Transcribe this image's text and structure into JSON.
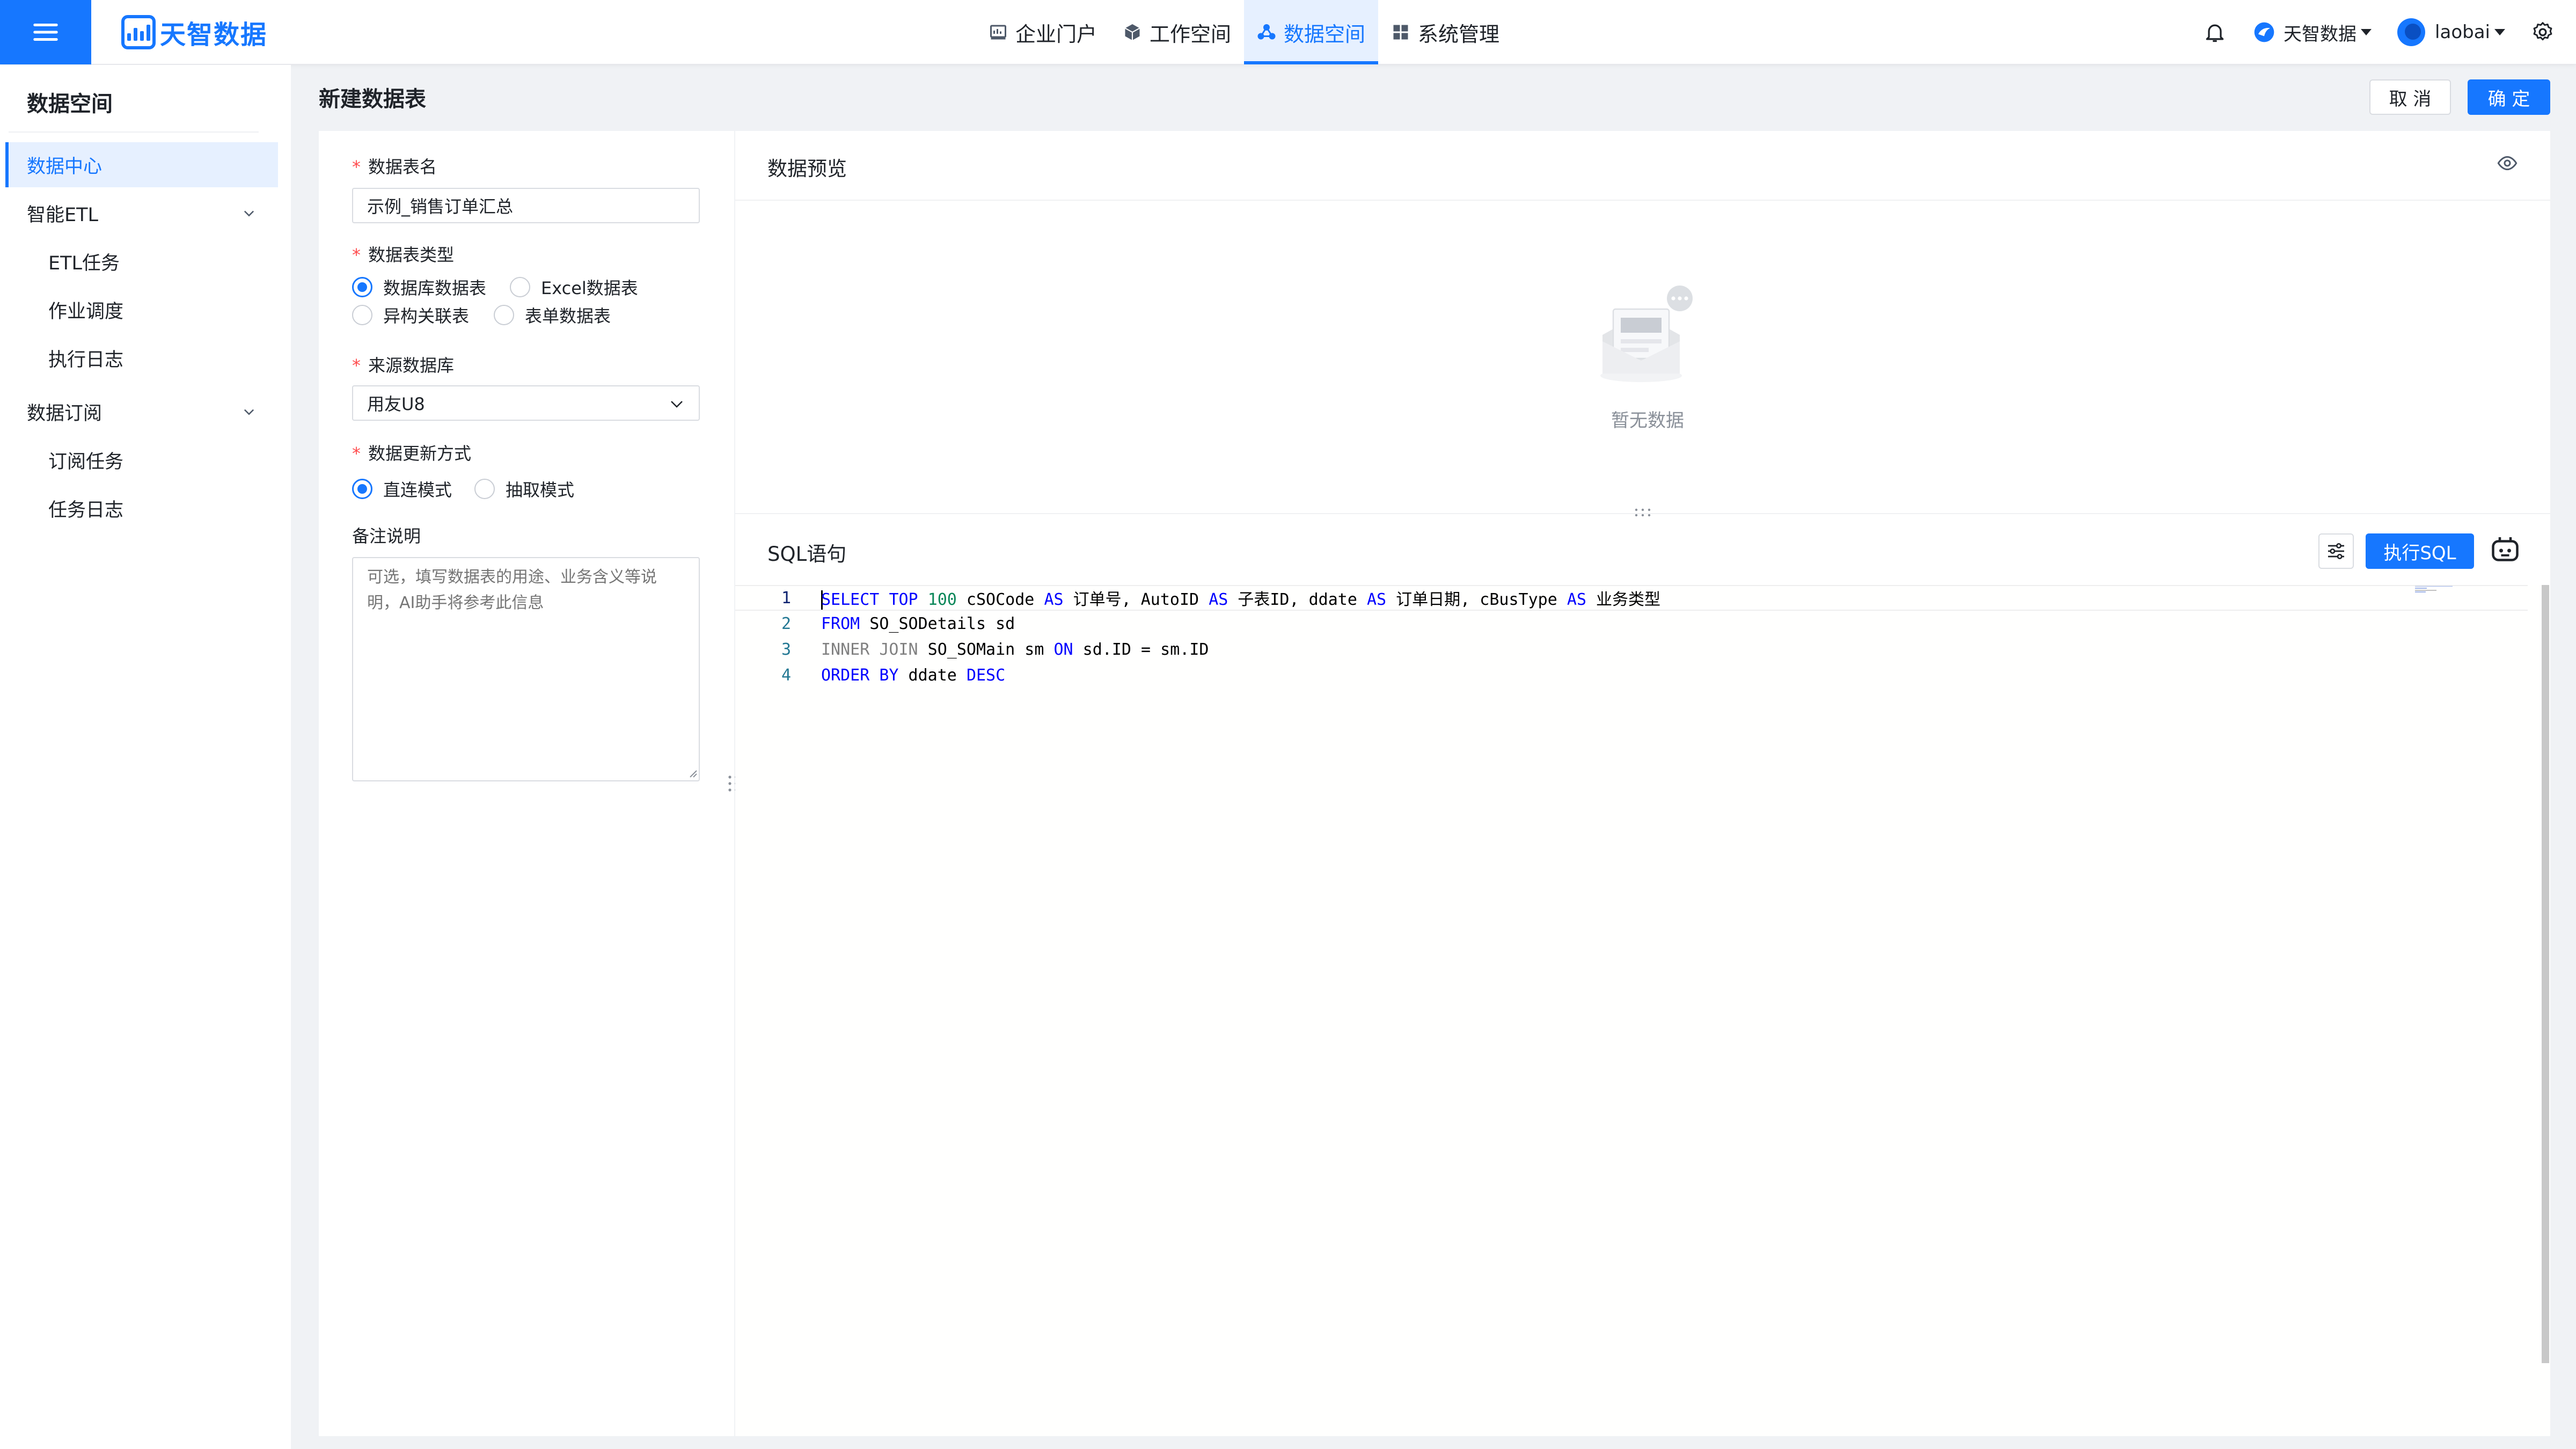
{
  "app": {
    "brand": "天智数据"
  },
  "nav": {
    "items": [
      {
        "label": "企业门户",
        "icon": "portal-icon"
      },
      {
        "label": "工作空间",
        "icon": "cube-icon"
      },
      {
        "label": "数据空间",
        "icon": "data-space-icon",
        "active": true
      },
      {
        "label": "系统管理",
        "icon": "grid-icon"
      }
    ]
  },
  "user_bar": {
    "team": "天智数据",
    "user": "laobai"
  },
  "sidebar": {
    "title": "数据空间",
    "items": [
      {
        "label": "数据中心",
        "level": 1,
        "active": true
      },
      {
        "label": "智能ETL",
        "level": 1,
        "expandable": true
      },
      {
        "label": "ETL任务",
        "level": 2
      },
      {
        "label": "作业调度",
        "level": 2
      },
      {
        "label": "执行日志",
        "level": 2
      },
      {
        "label": "数据订阅",
        "level": 1,
        "expandable": true
      },
      {
        "label": "订阅任务",
        "level": 2
      },
      {
        "label": "任务日志",
        "level": 2
      }
    ]
  },
  "page": {
    "title": "新建数据表",
    "cancel_label": "取 消",
    "ok_label": "确 定"
  },
  "form": {
    "table_name": {
      "label": "数据表名",
      "value": "示例_销售订单汇总"
    },
    "table_type": {
      "label": "数据表类型",
      "options": [
        "数据库数据表",
        "Excel数据表",
        "异构关联表",
        "表单数据表"
      ],
      "selected": "数据库数据表"
    },
    "source_db": {
      "label": "来源数据库",
      "value": "用友U8"
    },
    "update_mode": {
      "label": "数据更新方式",
      "options": [
        "直连模式",
        "抽取模式"
      ],
      "selected": "直连模式"
    },
    "remark": {
      "label": "备注说明",
      "placeholder": "可选，填写数据表的用途、业务含义等说明，AI助手将参考此信息"
    }
  },
  "preview": {
    "title": "数据预览",
    "empty_text": "暂无数据"
  },
  "sql": {
    "title": "SQL语句",
    "run_label": "执行SQL",
    "lines": [
      {
        "no": "1",
        "text": "SELECT TOP 100 cSOCode AS 订单号, AutoID AS 子表ID, ddate AS 订单日期, cBusType AS 业务类型"
      },
      {
        "no": "2",
        "text": "FROM SO_SODetails sd"
      },
      {
        "no": "3",
        "text": "INNER JOIN SO_SOMain sm ON sd.ID = sm.ID"
      },
      {
        "no": "4",
        "text": "ORDER BY ddate DESC"
      }
    ]
  },
  "colors": {
    "primary": "#1677ff",
    "required": "#ff4d4f",
    "keyword": "#0000ff",
    "number": "#098658",
    "line_number": "#237893"
  }
}
